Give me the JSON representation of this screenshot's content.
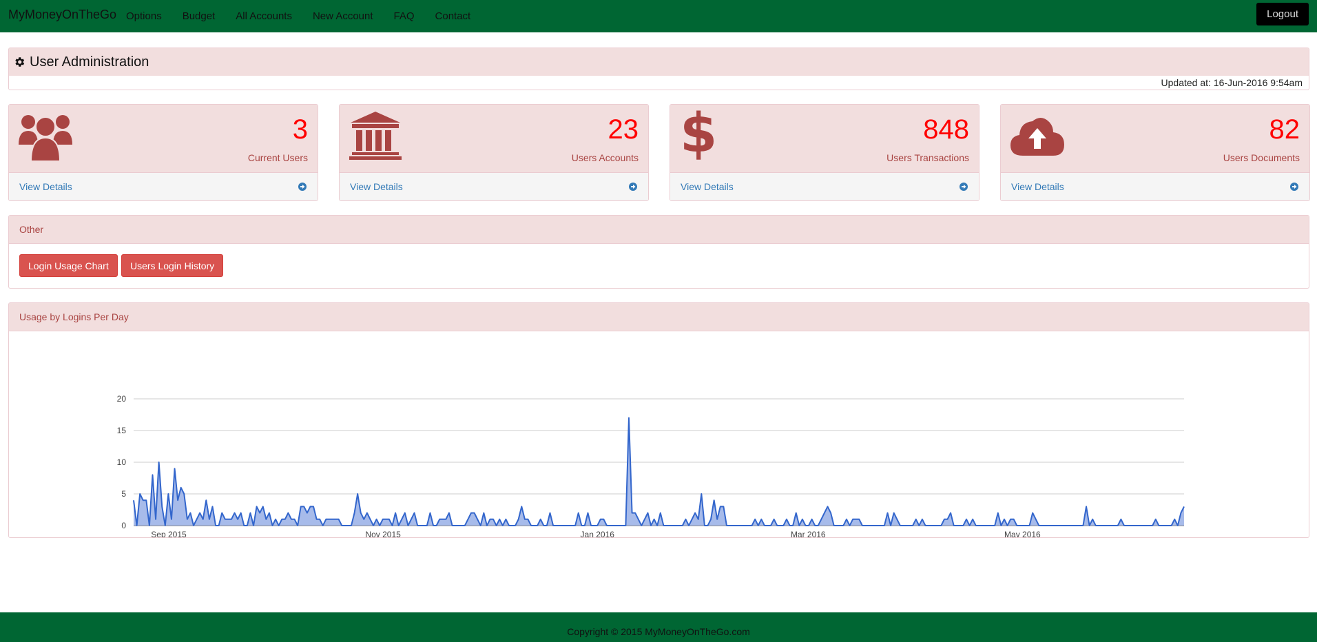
{
  "navbar": {
    "brand": "MyMoneyOnTheGo",
    "links": [
      "Options",
      "Budget",
      "All Accounts",
      "New Account",
      "FAQ",
      "Contact"
    ],
    "logout_label": "Logout"
  },
  "header": {
    "title": "User Administration",
    "title_icon": "gear-icon",
    "updated": "Updated at: 16-Jun-2016 9:54am"
  },
  "stats": [
    {
      "value": "3",
      "label": "Current Users",
      "icon": "users-icon",
      "link": "View Details"
    },
    {
      "value": "23",
      "label": "Users Accounts",
      "icon": "bank-icon",
      "link": "View Details"
    },
    {
      "value": "848",
      "label": "Users Transactions",
      "icon": "dollar-icon",
      "link": "View Details"
    },
    {
      "value": "82",
      "label": "Users Documents",
      "icon": "cloud-upload-icon",
      "link": "View Details"
    }
  ],
  "other": {
    "heading": "Other",
    "buttons": [
      "Login Usage Chart",
      "Users Login History"
    ]
  },
  "usage": {
    "heading": "Usage by Logins Per Day"
  },
  "colors": {
    "navbar": "#006633",
    "panel_heading_bg": "#f2dede",
    "panel_heading_text": "#a94442",
    "stat_value": "#ff0000",
    "link": "#337ab7",
    "button": "#d9534f",
    "chart_line": "#3366cc",
    "chart_fill": "#9db4e8"
  },
  "chart_data": {
    "type": "area",
    "title": "",
    "xlabel": "",
    "ylabel": "",
    "x_start": "2015-08-22",
    "x_end": "2016-06-16",
    "ylim": [
      0,
      20
    ],
    "y_ticks": [
      0,
      5,
      10,
      15,
      20
    ],
    "x_ticks": [
      "Sep 2015",
      "Nov 2015",
      "Jan 2016",
      "Mar 2016",
      "May 2016"
    ],
    "grid": true,
    "series": [
      {
        "values": [
          4,
          0,
          5,
          4,
          4,
          0,
          8,
          1,
          10,
          3,
          0,
          5,
          1,
          9,
          4,
          6,
          5,
          1,
          2,
          0,
          1,
          2,
          1,
          4,
          1,
          3,
          0,
          0,
          2,
          1,
          1,
          1,
          2,
          1,
          2,
          0,
          0,
          2,
          0,
          3,
          2,
          3,
          1,
          2,
          0,
          1,
          0,
          1,
          1,
          2,
          1,
          1,
          0,
          3,
          3,
          2,
          3,
          3,
          1,
          1,
          0,
          1,
          1,
          1,
          1,
          1,
          0,
          0,
          0,
          0,
          2,
          5,
          2,
          1,
          2,
          1,
          0,
          1,
          0,
          1,
          1,
          1,
          0,
          2,
          0,
          1,
          2,
          0,
          1,
          2,
          0,
          0,
          0,
          0,
          2,
          0,
          0,
          1,
          1,
          1,
          2,
          0,
          0,
          0,
          0,
          0,
          1,
          2,
          2,
          1,
          0,
          2,
          0,
          1,
          1,
          0,
          1,
          0,
          1,
          0,
          0,
          0,
          1,
          3,
          1,
          1,
          0,
          0,
          0,
          1,
          0,
          0,
          2,
          0,
          0,
          0,
          0,
          0,
          0,
          0,
          0,
          2,
          0,
          0,
          2,
          0,
          0,
          0,
          1,
          1,
          0,
          0,
          0,
          0,
          0,
          0,
          0,
          17,
          2,
          2,
          1,
          0,
          1,
          2,
          0,
          1,
          0,
          2,
          0,
          0,
          0,
          0,
          0,
          0,
          0,
          1,
          0,
          1,
          2,
          1,
          5,
          0,
          0,
          1,
          4,
          1,
          3,
          3,
          0,
          0,
          0,
          0,
          0,
          0,
          0,
          0,
          0,
          1,
          0,
          1,
          0,
          0,
          0,
          1,
          0,
          0,
          0,
          1,
          0,
          0,
          2,
          0,
          1,
          0,
          0,
          1,
          0,
          0,
          1,
          2,
          3,
          2,
          0,
          0,
          0,
          0,
          1,
          0,
          1,
          1,
          1,
          0,
          0,
          0,
          0,
          0,
          0,
          0,
          0,
          2,
          0,
          2,
          1,
          0,
          0,
          0,
          0,
          0,
          1,
          0,
          1,
          0,
          0,
          0,
          0,
          0,
          0,
          1,
          1,
          2,
          0,
          0,
          0,
          0,
          1,
          0,
          1,
          0,
          0,
          0,
          0,
          0,
          0,
          0,
          2,
          0,
          1,
          0,
          1,
          1,
          0,
          0,
          0,
          0,
          0,
          2,
          1,
          0,
          0,
          0,
          0,
          0,
          0,
          0,
          0,
          0,
          0,
          0,
          0,
          0,
          0,
          0,
          3,
          0,
          1,
          0,
          0,
          0,
          0,
          0,
          0,
          0,
          0,
          1,
          0,
          0,
          0,
          0,
          0,
          0,
          0,
          0,
          0,
          0,
          1,
          0,
          0,
          0,
          0,
          0,
          1,
          0,
          2,
          3
        ]
      }
    ]
  }
}
